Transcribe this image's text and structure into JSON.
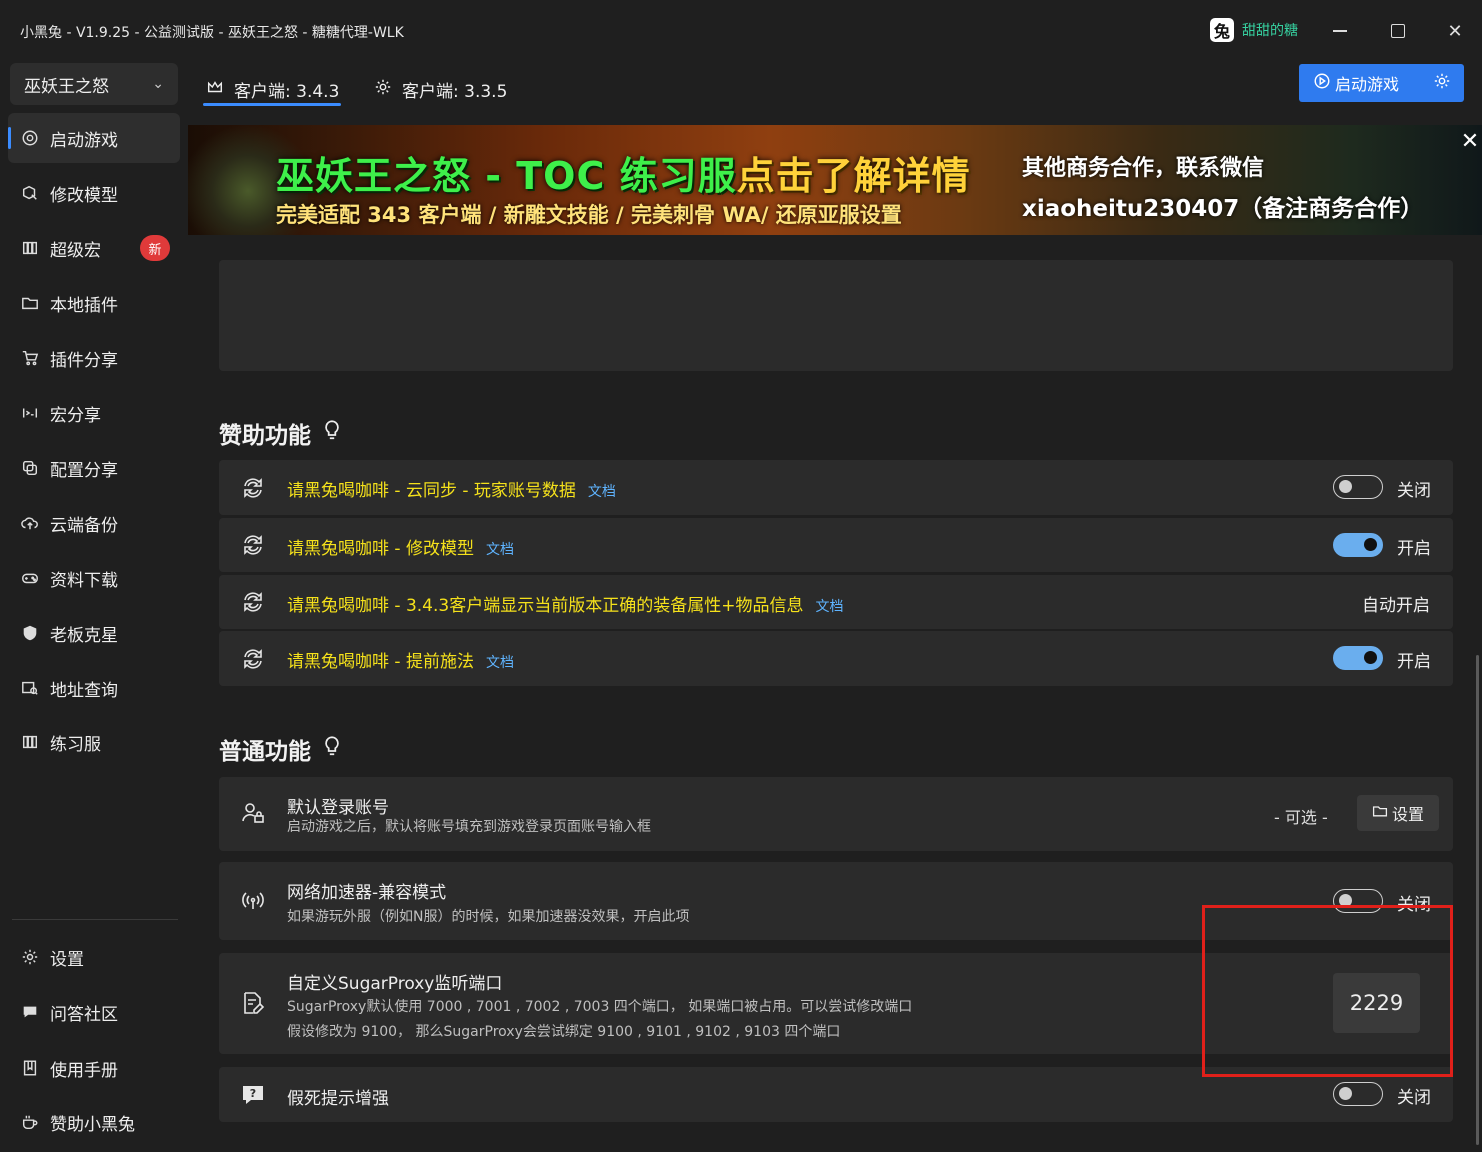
{
  "window": {
    "title": "小黑兔 - V1.9.25 - 公益测试版 - 巫妖王之怒 - 糖糖代理-WLK",
    "logo_char": "兔",
    "user_name": "甜甜的糖",
    "close_glyph": "✕"
  },
  "sidebar": {
    "game_select": "巫妖王之怒",
    "items": [
      {
        "label": "启动游戏",
        "icon": "target-icon"
      },
      {
        "label": "修改模型",
        "icon": "cube-edit-icon"
      },
      {
        "label": "超级宏",
        "icon": "columns-icon",
        "badge": "新"
      },
      {
        "label": "本地插件",
        "icon": "folder-icon"
      },
      {
        "label": "插件分享",
        "icon": "cart-icon"
      },
      {
        "label": "宏分享",
        "icon": "code-icon"
      },
      {
        "label": "配置分享",
        "icon": "copy-icon"
      },
      {
        "label": "云端备份",
        "icon": "cloud-upload-icon"
      },
      {
        "label": "资料下载",
        "icon": "gamepad-icon"
      },
      {
        "label": "老板克星",
        "icon": "shield-icon"
      },
      {
        "label": "地址查询",
        "icon": "map-search-icon"
      },
      {
        "label": "练习服",
        "icon": "columns-icon"
      }
    ],
    "bottom_items": [
      {
        "label": "设置",
        "icon": "gear-icon"
      },
      {
        "label": "问答社区",
        "icon": "chat-icon"
      },
      {
        "label": "使用手册",
        "icon": "book-icon"
      },
      {
        "label": "赞助小黑兔",
        "icon": "coffee-icon"
      }
    ]
  },
  "tabs": [
    {
      "label": "客户端: 3.4.3",
      "icon": "crown-icon",
      "active": true
    },
    {
      "label": "客户端: 3.3.5",
      "icon": "gear-icon",
      "active": false
    }
  ],
  "launch_button": {
    "label": "启动游戏"
  },
  "banner": {
    "line1_green": "巫妖王之怒 - TOC 练习服",
    "line1_yellow": "点击了解详情",
    "line2": "完美适配 343 客户端 / 新雕文技能 / 完美刺骨 WA/ 还原亚服设置",
    "right1": "其他商务合作，联系微信",
    "right2": "xiaoheitu230407（备注商务合作）",
    "close_glyph": "✕"
  },
  "sponsor_section": {
    "title": "赞助功能",
    "rows": [
      {
        "label": "请黑兔喝咖啡 - 云同步 - 玩家账号数据",
        "doc": "文档",
        "state": "关闭",
        "on": false
      },
      {
        "label": "请黑兔喝咖啡 - 修改模型",
        "doc": "文档",
        "state": "开启",
        "on": true
      },
      {
        "label": "请黑兔喝咖啡 - 3.4.3客户端显示当前版本正确的装备属性+物品信息",
        "doc": "文档",
        "state": "自动开启"
      },
      {
        "label": "请黑兔喝咖啡 - 提前施法",
        "doc": "文档",
        "state": "开启",
        "on": true
      }
    ]
  },
  "normal_section": {
    "title": "普通功能",
    "default_account": {
      "title": "默认登录账号",
      "desc": "启动游戏之后，默认将账号填充到游戏登录页面账号输入框",
      "optional": "- 可选 -",
      "button": "设置"
    },
    "network": {
      "title": "网络加速器-兼容模式",
      "desc": "如果游玩外服（例如N服）的时候，如果加速器没效果，开启此项",
      "state": "关闭"
    },
    "proxy_port": {
      "title": "自定义SugarProxy监听端口",
      "desc1": "SugarProxy默认使用 7000 , 7001 , 7002 , 7003 四个端口， 如果端口被占用。可以尝试修改端口",
      "desc2": "假设修改为 9100， 那么SugarProxy会尝试绑定 9100 , 9101 , 9102 , 9103 四个端口",
      "value": "2229"
    },
    "fake_death": {
      "title": "假死提示增强",
      "state": "关闭"
    }
  },
  "colors": {
    "accent": "#2f7bef",
    "sponsor_text": "#f5e11b",
    "doc_link": "#5fb4ff",
    "highlight_box": "#e0201a",
    "badge": "#e03a3a",
    "toggle_on": "#6aaeee"
  }
}
